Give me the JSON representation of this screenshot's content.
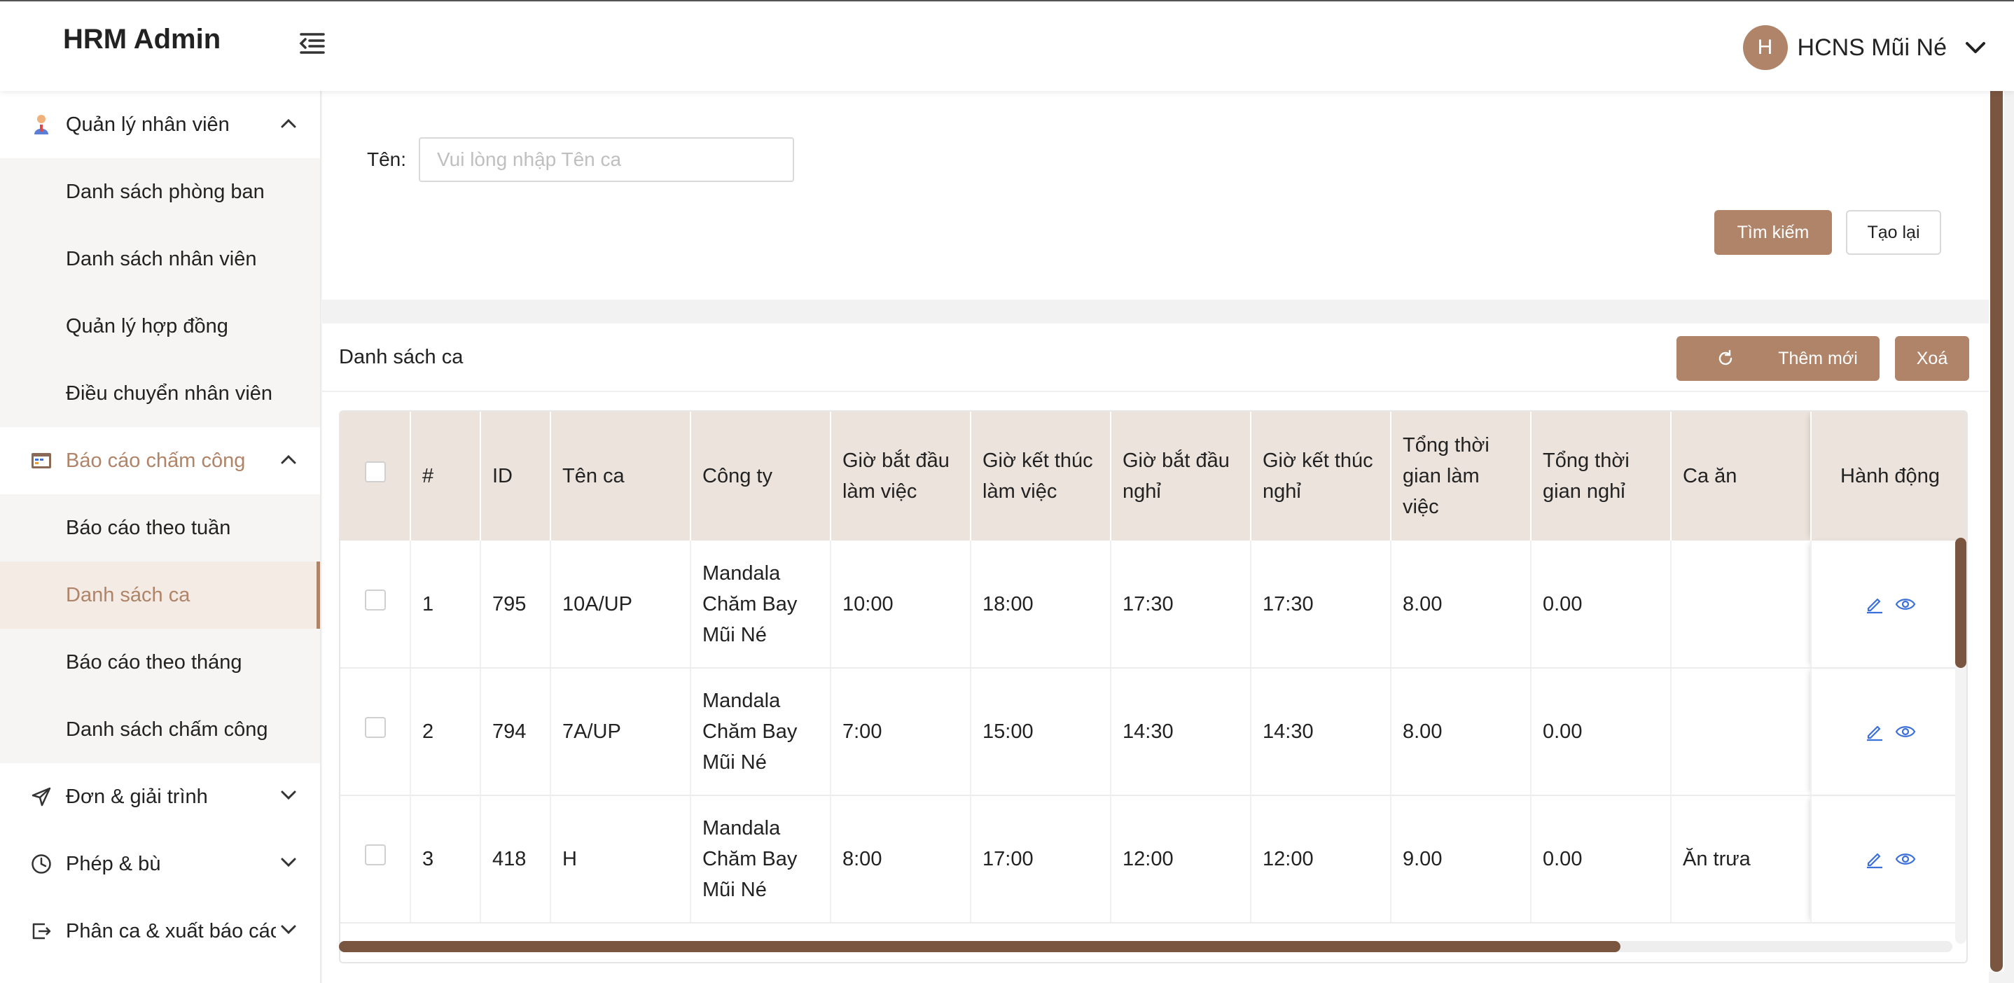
{
  "app": {
    "title": "HRM Admin"
  },
  "user": {
    "initial": "H",
    "name": "HCNS Mũi Né"
  },
  "sidebar": {
    "groups": [
      {
        "label": "Quản lý nhân viên",
        "icon": "person-icon",
        "expanded": true,
        "items": [
          "Danh sách phòng ban",
          "Danh sách nhân viên",
          "Quản lý hợp đồng",
          "Điều chuyển nhân viên"
        ]
      },
      {
        "label": "Báo cáo chấm công",
        "icon": "timesheet-icon",
        "expanded": true,
        "items": [
          "Báo cáo theo tuần",
          "Danh sách ca",
          "Báo cáo theo tháng",
          "Danh sách chấm công"
        ]
      },
      {
        "label": "Đơn & giải trình",
        "icon": "send-icon",
        "expanded": false
      },
      {
        "label": "Phép & bù",
        "icon": "clock-icon",
        "expanded": false
      },
      {
        "label": "Phân ca & xuất báo cáo",
        "icon": "export-icon",
        "expanded": false
      }
    ],
    "selected_item": "Danh sách ca"
  },
  "search": {
    "name_label": "Tên",
    "name_colon": ":",
    "name_placeholder": "Vui lòng nhập Tên ca",
    "name_value": "",
    "search_button": "Tìm kiếm",
    "reset_button": "Tạo lại"
  },
  "list": {
    "title": "Danh sách ca",
    "add_button": "Thêm mới",
    "delete_button": "Xoá",
    "columns": [
      "#",
      "ID",
      "Tên ca",
      "Công ty",
      "Giờ bắt đầu làm việc",
      "Giờ kết thúc làm việc",
      "Giờ bắt đầu nghỉ",
      "Giờ kết thúc nghỉ",
      "Tổng thời gian làm việc",
      "Tổng thời gian nghỉ",
      "Ca ăn",
      "Hành động"
    ],
    "rows": [
      {
        "no": "1",
        "id": "795",
        "name": "10A/UP",
        "company": "Mandala Chăm Bay Mũi Né",
        "work_start": "10:00",
        "work_end": "18:00",
        "break_start": "17:30",
        "break_end": "17:30",
        "total_work": "8.00",
        "total_break": "0.00",
        "meal": ""
      },
      {
        "no": "2",
        "id": "794",
        "name": "7A/UP",
        "company": "Mandala Chăm Bay Mũi Né",
        "work_start": "7:00",
        "work_end": "15:00",
        "break_start": "14:30",
        "break_end": "14:30",
        "total_work": "8.00",
        "total_break": "0.00",
        "meal": ""
      },
      {
        "no": "3",
        "id": "418",
        "name": "H",
        "company": "Mandala Chăm Bay Mũi Né",
        "work_start": "8:00",
        "work_end": "17:00",
        "break_start": "12:00",
        "break_end": "12:00",
        "total_work": "9.00",
        "total_break": "0.00",
        "meal": "Ăn trưa"
      }
    ]
  },
  "colors": {
    "accent": "#b08469",
    "header_bg": "#ede3dd",
    "scroll": "#7a5640",
    "action_icons": "#3b6fd9"
  }
}
